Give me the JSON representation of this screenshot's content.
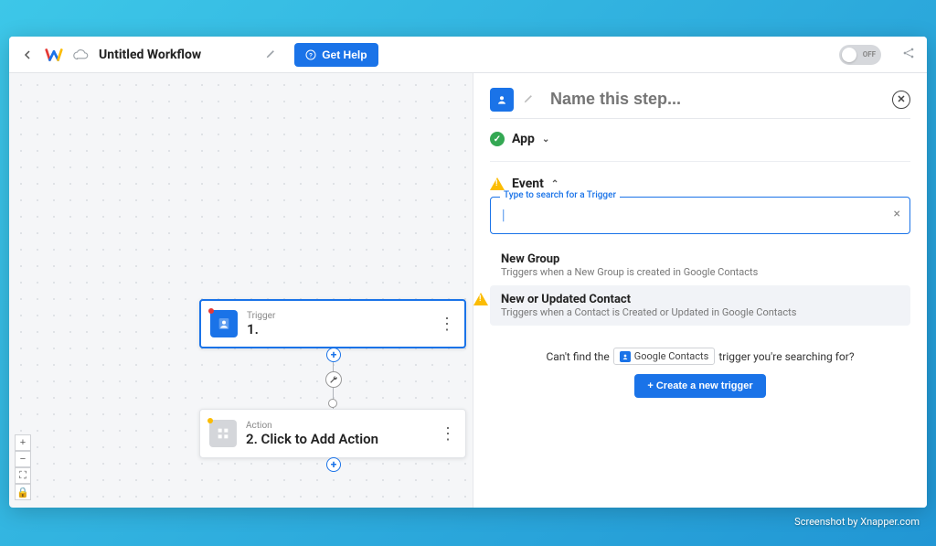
{
  "header": {
    "title": "Untitled Workflow",
    "get_help_label": "Get Help",
    "toggle_label": "OFF"
  },
  "canvas": {
    "trigger": {
      "label": "Trigger",
      "name": "1."
    },
    "action": {
      "label": "Action",
      "name": "2. Click to Add Action"
    },
    "zoom": {
      "plus": "+",
      "minus": "−",
      "fit": "⛶",
      "lock": "🔒"
    }
  },
  "panel": {
    "step_name_placeholder": "Name this step...",
    "app_section": "App",
    "event_section": "Event",
    "search_label": "Type to search for a Trigger",
    "search_value": "",
    "search_caret": "|",
    "options": [
      {
        "title": "New Group",
        "desc": "Triggers when a New Group is created in Google Contacts"
      },
      {
        "title": "New or Updated Contact",
        "desc": "Triggers when a Contact is Created or Updated in Google Contacts"
      }
    ],
    "cant_find_pre": "Can't find the",
    "cant_find_chip": "Google Contacts",
    "cant_find_post": "trigger you're searching for?",
    "create_trigger_label": "+ Create a new trigger"
  },
  "footer": {
    "credit": "Screenshot by Xnapper.com"
  }
}
